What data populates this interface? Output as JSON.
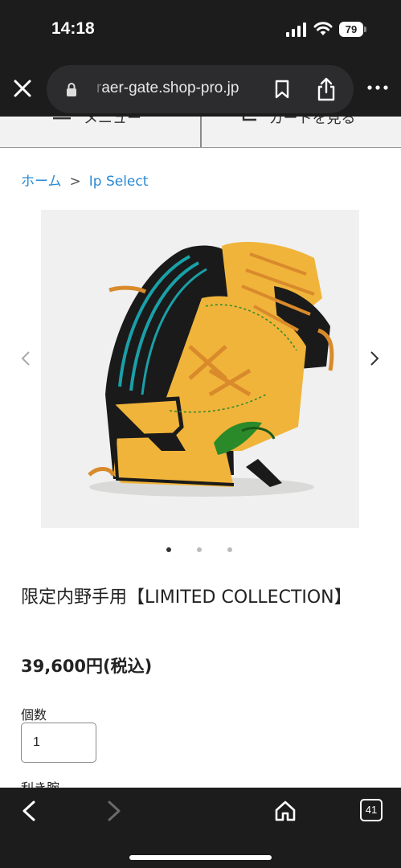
{
  "status": {
    "time": "14:18",
    "battery": "79"
  },
  "browser": {
    "url_faded": "r",
    "url": "aer-gate.shop-pro.jp"
  },
  "nav": {
    "menu_label": "メニュー",
    "cart_label": "カートを見る"
  },
  "breadcrumb": {
    "home": "ホーム",
    "separator": ">",
    "category": "Ip Select"
  },
  "gallery": {
    "slide_count": 3,
    "active_index": 0
  },
  "product": {
    "title": "限定内野手用【LIMITED COLLECTION】",
    "price": "39,600円(税込)",
    "quantity_label": "個数",
    "quantity_value": "1",
    "hand_label": "利き腕"
  },
  "toolbar": {
    "tab_count": "41"
  },
  "colors": {
    "link": "#2a8ad4",
    "glove_tan": "#f0b43a",
    "glove_black": "#1a1a1a",
    "glove_teal": "#1aa0a8",
    "lace": "#d98a2b"
  }
}
